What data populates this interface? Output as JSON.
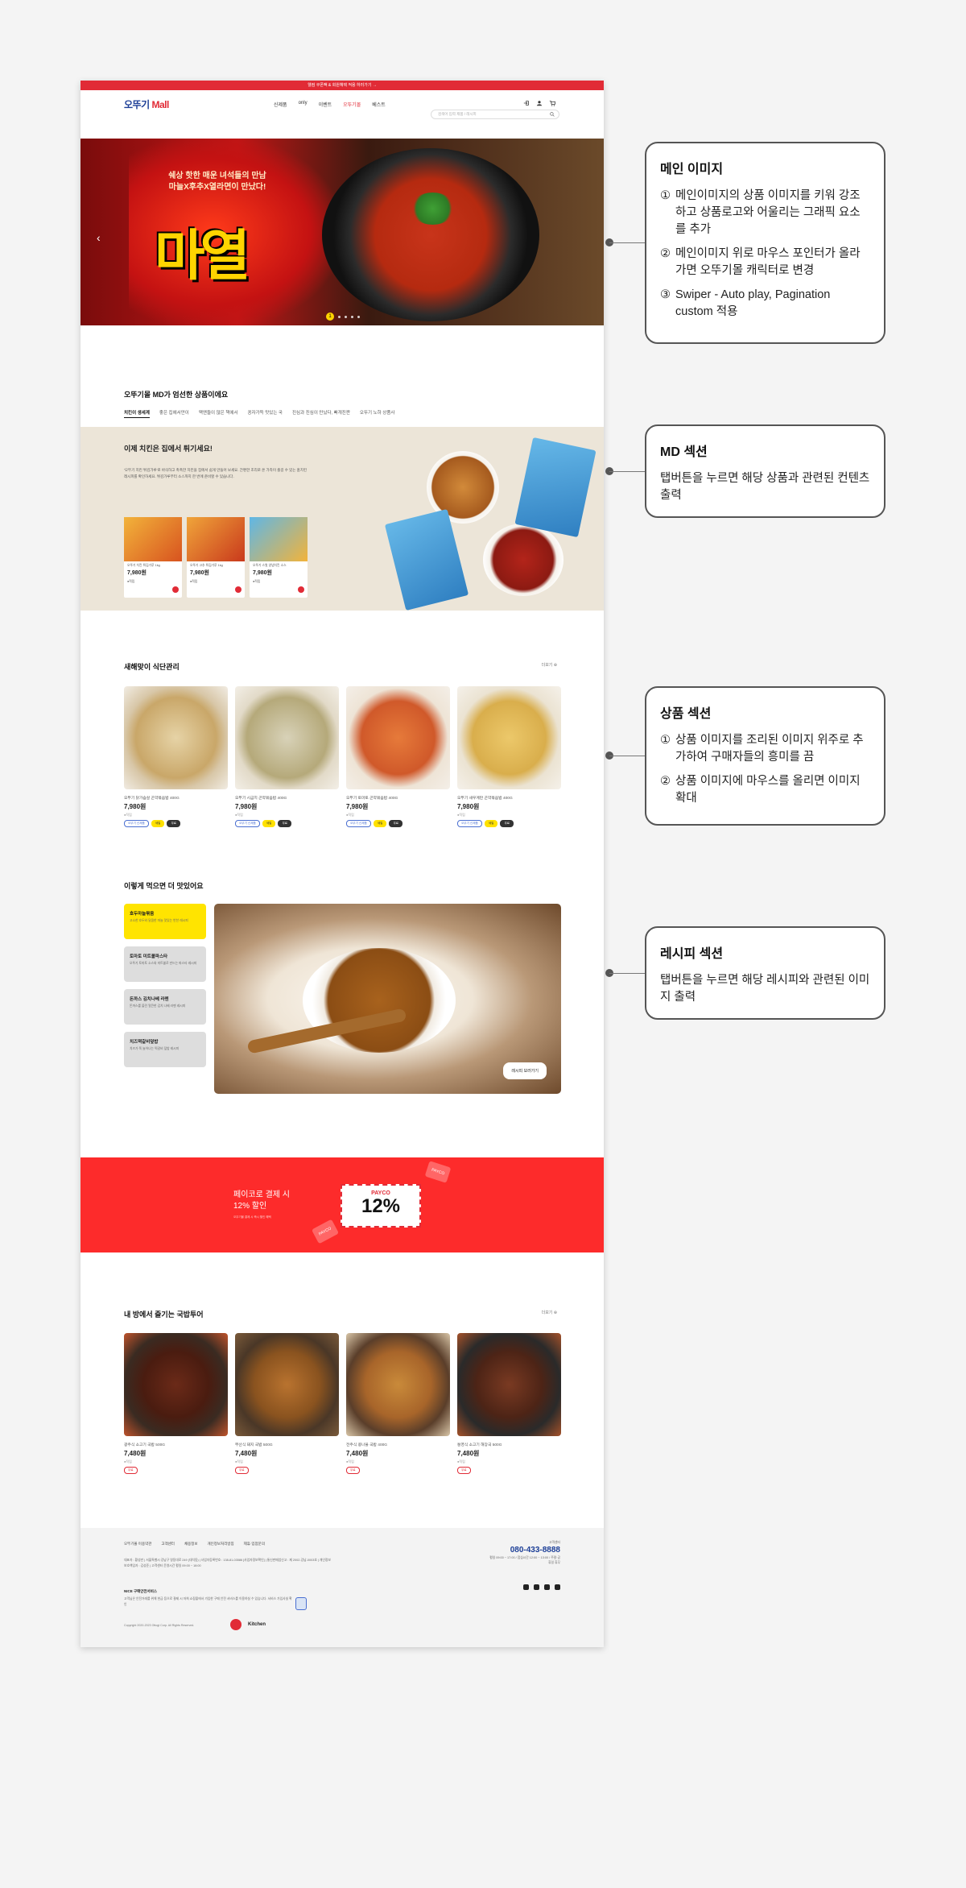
{
  "site": {
    "top_notice": "웰컴 쿠폰팩 & 회원혜택 적용 하러가기 →",
    "logo_main": "오뚜기",
    "logo_accent": "Mall",
    "nav": [
      "신제품",
      "only",
      "이벤트",
      "오뚜기몰",
      "베스트"
    ],
    "search_placeholder": "검색어 입력 제품 / 레시피"
  },
  "hero": {
    "copy_line1": "쉐상 핫한 매운 녀석들의 만남",
    "copy_line2": "마늘X후추X열라면이 만났다!",
    "title": "마열",
    "slide_current": "1"
  },
  "md_section": {
    "title": "오뚜기몰 MD가 엄선한 상품이에요",
    "tabs": [
      "치킨이 생세계",
      "좋은 집에서만이",
      "맥앤들이 많은 책에서",
      "꽁자가득 맛있는 국",
      "진심과 진심이 만났다, 빠개진짠",
      "오뚜기 노하 상품사"
    ],
    "promo_title": "이제 치킨은 집에서 튀기세요!",
    "promo_desc": "'오뚜기 치킨 튀김가루'로 바삭하고 촉촉한 치킨을 집에서 쉽게 만들어 보세요. 간편한 조리로 온 가족이 즐길 수 있는 홈치킨 레시피를 확인하세요. 튀김가루부터 소스까지 한 번에 준비할 수 있습니다.",
    "products": [
      {
        "name": "오뚜기 치킨 튀김가루 1kg",
        "price": "7,980원",
        "pt": "●적립"
      },
      {
        "name": "오뚜기 고추 튀김가루 1kg",
        "price": "7,980원",
        "pt": "●적립"
      },
      {
        "name": "오뚜기 스윗 양념치킨 소스",
        "price": "7,980원",
        "pt": "●적립"
      }
    ]
  },
  "diet_section": {
    "title": "새해맞이 식단관리",
    "more": "더보기",
    "products": [
      {
        "name": "오뚜기 닭가슴살 곤약볶음밥 400G",
        "price": "7,980원",
        "pt": "●적립",
        "tags": [
          "오뚜기 신제품",
          "세일",
          "무료"
        ]
      },
      {
        "name": "오뚜기 시금치 곤약볶음밥 400G",
        "price": "7,980원",
        "pt": "●적립",
        "tags": [
          "오뚜기 신제품",
          "세일",
          "무료"
        ]
      },
      {
        "name": "오뚜기 토마토 곤약볶음밥 400G",
        "price": "7,980원",
        "pt": "●적립",
        "tags": [
          "오뚜기 신제품",
          "세일",
          "무료"
        ]
      },
      {
        "name": "오뚜기 새우계란 곤약볶음밥 400G",
        "price": "7,980원",
        "pt": "●적립",
        "tags": [
          "오뚜기 신제품",
          "세일",
          "무료"
        ]
      }
    ]
  },
  "recipe_section": {
    "title": "이렇게 먹으면 더 맛있어요",
    "tabs": [
      {
        "title": "호두마늘볶음",
        "desc": "고소한 호두와 달콤한 마늘 맛있는 반찬 레시피"
      },
      {
        "title": "토마토 미트볼파스타",
        "desc": "오뚜기 토마토 소스와 미트볼로 만드는 파스타 레시피"
      },
      {
        "title": "돈까스 김치나베 라멘",
        "desc": "돈까스를 올린 얼큰한 김치 나베 라멘 레시피"
      },
      {
        "title": "치즈떡갈비덮밥",
        "desc": "치즈가 쭉 늘어나는 떡갈비 덮밥 레시피"
      }
    ],
    "cta": "레시피 보러가기"
  },
  "payco": {
    "line1": "페이코로 결제 시",
    "line2": "12% 할인",
    "small": "오뚜기몰 결제 시 즉시 할인 혜택",
    "badge_top": "PAYCO",
    "badge_value": "12%",
    "chip": "PAYCO"
  },
  "soup_section": {
    "title": "내 방에서 즐기는 국밥투어",
    "more": "더보기",
    "products": [
      {
        "name": "광주식 소고기 국밥 500G",
        "price": "7,480원",
        "pt": "●적립",
        "tag": "무료"
      },
      {
        "name": "부산식 돼지 국밥 500G",
        "price": "7,480원",
        "pt": "●적립",
        "tag": "무료"
      },
      {
        "name": "전주식 콩나물 국밥 400G",
        "price": "7,480원",
        "pt": "●적립",
        "tag": "무료"
      },
      {
        "name": "통영식 소고기 해장국 500G",
        "price": "7,480원",
        "pt": "●적립",
        "tag": "무료"
      }
    ]
  },
  "footer": {
    "links": [
      "오뚜기몰 이용약관",
      "고객센터",
      "채용정보",
      "개인정보처리방침",
      "제휴·입점문의"
    ],
    "info": "대표자 : 황성만 | 서울특별시 강남구 영동대로 249 (대치동) | 사업자등록번호 : 138-81-03586 [사업자정보확인] | 통신판매업신고 : 제 2002-강남-0003호 | 개인정보보호책임자 : 김성준 | 고객센터 운영시간 평일 09:00 ~ 18:00",
    "nice_title": "NICE 구매안전서비스",
    "nice_text": "고객님은 안전거래를 위해 현금 등으로 결제 시 저희 쇼핑몰에서 가입한 구매 안전 서비스를 이용하실 수 있습니다. 서비스 가입사실 확인",
    "copyright": "Copyright 2020-2023 Ottogi Corp. All Rights Reserved.",
    "kitchen": "Kitchen",
    "cs_label": "고객센터",
    "phone": "080-433-8888",
    "hours": "평일 09:00 ~ 17:00 / 점심시간 12:00 ~ 13:00 / 주말·공휴일 휴무"
  },
  "annotations": [
    {
      "title": "메인 이미지",
      "items": [
        {
          "num": "①",
          "text": "메인이미지의 상품 이미지를 키워 강조하고 상품로고와 어울리는 그래픽 요소를 추가"
        },
        {
          "num": "②",
          "text": "메인이미지 위로 마우스 포인터가 올라가면 오뚜기몰 캐릭터로 변경"
        },
        {
          "num": "③",
          "text": "Swiper - Auto play, Pagination custom 적용"
        }
      ]
    },
    {
      "title": "MD 섹션",
      "text": "탭버튼을 누르면 해당 상품과 관련된 컨텐츠 출력"
    },
    {
      "title": "상품 섹션",
      "items": [
        {
          "num": "①",
          "text": "상품 이미지를 조리된 이미지 위주로 추가하여 구매자들의 흥미를 끔"
        },
        {
          "num": "②",
          "text": "상품 이미지에 마우스를 올리면 이미지 확대"
        }
      ]
    },
    {
      "title": "레시피 섹션",
      "text": "탭버튼을 누르면 해당 레시피와 관련된 이미지 출력"
    }
  ],
  "colors": {
    "brand_red": "#e12b36",
    "brand_blue": "#1d3f97",
    "payco_red": "#fd2b2b",
    "highlight_yellow": "#ffe400"
  }
}
